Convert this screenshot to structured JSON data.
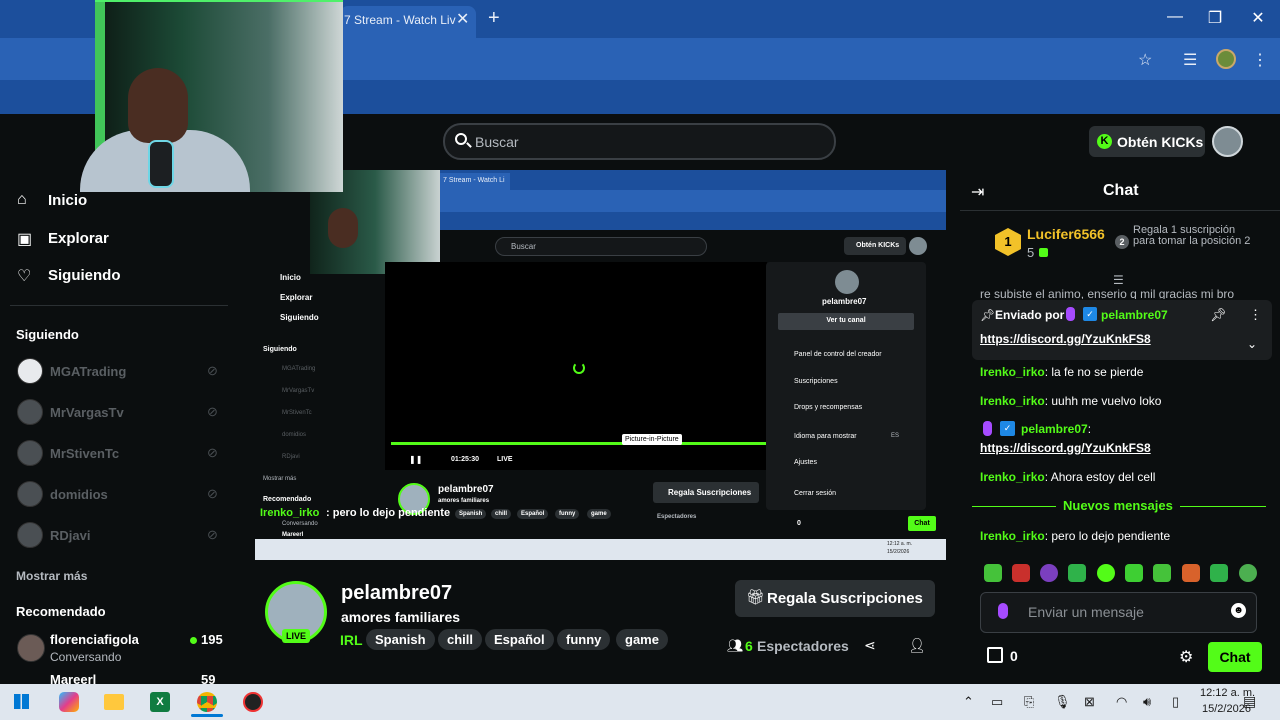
{
  "browser": {
    "tab_title": "7 Stream - Watch Liv",
    "tab_close": "✕",
    "new_tab": "+",
    "minimize": "—",
    "maximize": "❐",
    "close": "✕"
  },
  "header": {
    "search_placeholder": "Buscar",
    "kicks_label": "Obtén KICKs",
    "kicks_k": "K"
  },
  "sidebar": {
    "nav": [
      {
        "label": "Inicio",
        "icon": "home-icon"
      },
      {
        "label": "Explorar",
        "icon": "explore-icon"
      },
      {
        "label": "Siguiendo",
        "icon": "heart-icon"
      }
    ],
    "following_title": "Siguiendo",
    "following": [
      "MGATrading",
      "MrVargasTv",
      "MrStivenTc",
      "domidios",
      "RDjavi"
    ],
    "show_more": "Mostrar más",
    "recommended_title": "Recomendado",
    "recommended": [
      {
        "name": "florenciafigola",
        "category": "Conversando",
        "viewers": "195"
      },
      {
        "name": "Mareerl",
        "viewers": "59"
      }
    ]
  },
  "nested": {
    "tab_title": "7 Stream - Watch Li",
    "search_placeholder": "Buscar",
    "kicks_label": "Obtén KICKs",
    "nav": [
      "Inicio",
      "Explorar",
      "Siguiendo"
    ],
    "following_title": "Siguiendo",
    "following": [
      "MGATrading",
      "MrVargasTv",
      "MrStivenTc",
      "domidios",
      "RDjavi"
    ],
    "show_more": "Mostrar más",
    "recommended_title": "Recomendado",
    "recommended_sub": "Conversando",
    "recommended_last": "Mareerl",
    "time": "01:25:30",
    "live": "LIVE",
    "pip_tooltip": "Picture-in-Picture",
    "streamer": "pelambre07",
    "streamer_sub": "amores familiares",
    "tags": [
      "Spanish",
      "chill",
      "Español",
      "funny",
      "game"
    ],
    "gift": "Regala Suscripciones",
    "viewers": "Espectadores",
    "overlay_user": "Irenko_irko",
    "overlay_text": ": pero lo dejo pendiente",
    "kicks_count": "0",
    "chat_btn": "Chat",
    "menu": {
      "user": "pelambre07",
      "channel_btn": "Ver tu canal",
      "items": [
        "Panel de control del creador",
        "Suscripciones",
        "Drops y recompensas",
        "Idioma para mostrar",
        "Ajustes",
        "Cerrar sesión"
      ],
      "language_code": "ES"
    },
    "tray_time": "12:12 a. m.",
    "tray_date": "15/2/2026"
  },
  "stream": {
    "streamer": "pelambre07",
    "title": "amores familiares",
    "category": "IRL",
    "live_badge": "LIVE",
    "tags": [
      "Spanish",
      "chill",
      "Español",
      "funny",
      "game"
    ],
    "gift_label": "Regala Suscripciones",
    "viewers_count": "6",
    "viewers_label": "Espectadores"
  },
  "chat": {
    "title": "Chat",
    "top_gifter": {
      "rank": "1",
      "name": "Lucifer6566",
      "count": "5",
      "promo": "Regala 1 suscripción para tomar la posición 2",
      "promo_rank": "2"
    },
    "cut_message": "re subiste el animo, enserio q mil gracias mi bro",
    "pinned": {
      "label": "Enviado por",
      "user": "pelambre07",
      "link": "https://discord.gg/YzuKnkFS8"
    },
    "messages": [
      {
        "user": "Irenko_irko",
        "text": ": la fe no se pierde"
      },
      {
        "user": "Irenko_irko",
        "text": ": uuhh me vuelvo loko"
      }
    ],
    "streamer_msg": {
      "user": "pelambre07",
      "sep": ":",
      "link": "https://discord.gg/YzuKnkFS8"
    },
    "msg3": {
      "user": "Irenko_irko",
      "text": ": Ahora estoy del cell"
    },
    "new_messages": "Nuevos mensajes",
    "msg4": {
      "user": "Irenko_irko",
      "text": ": pero lo dejo pendiente"
    },
    "input_placeholder": "Enviar un mensaje",
    "kicks_count": "0",
    "send_label": "Chat",
    "colors": {
      "accent": "#53fc18",
      "gold": "#f2c229"
    }
  },
  "taskbar": {
    "time": "12:12 a. m.",
    "date": "15/2/2026"
  }
}
